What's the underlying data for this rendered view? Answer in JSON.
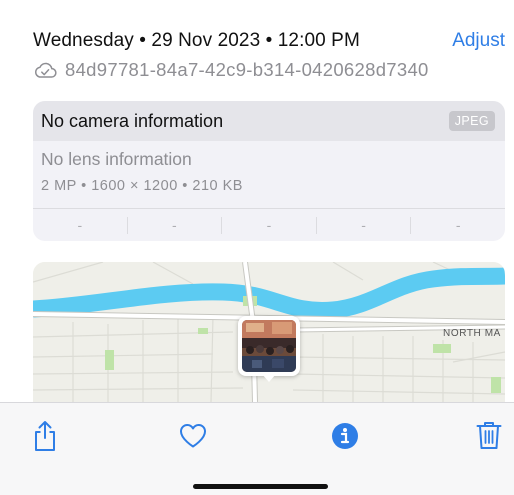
{
  "header": {
    "date": "Wednesday • 29 Nov 2023 • 12:00 PM",
    "adjust_label": "Adjust",
    "photo_id": "84d97781-84a7-42c9-b314-0420628d7340",
    "id_icon": "cloud-check-icon"
  },
  "info_card": {
    "camera": "No camera information",
    "format_badge": "JPEG",
    "lens": "No lens information",
    "specs": "2 MP  •  1600 × 1200  •  210 KB",
    "exif_values": [
      "-",
      "-",
      "-",
      "-",
      "-"
    ]
  },
  "map": {
    "street_label": "NORTH MA"
  },
  "toolbar": {
    "share_icon": "share-icon",
    "favorite_icon": "heart-icon",
    "info_icon": "info-icon",
    "delete_icon": "trash-icon"
  },
  "colors": {
    "accent": "#2f7ee6",
    "river": "#5ccbf2",
    "card_bg": "#f2f2f7"
  }
}
